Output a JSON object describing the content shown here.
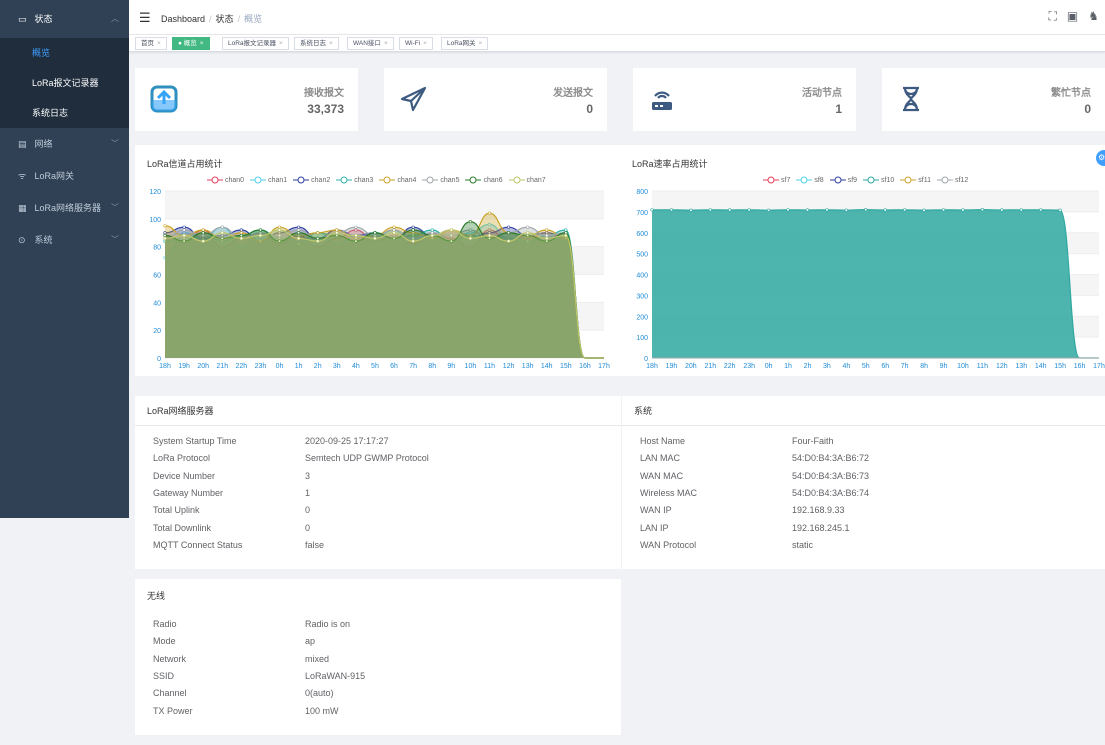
{
  "sidebar": {
    "groups": [
      {
        "label": "状态",
        "icon": "monitor-icon",
        "children": [
          "概览",
          "LoRa报文记录器",
          "系统日志"
        ]
      },
      {
        "label": "网络",
        "icon": "network-icon"
      },
      {
        "label": "LoRa网关",
        "icon": "gateway-icon"
      },
      {
        "label": "LoRa网络服务器",
        "icon": "server-icon"
      },
      {
        "label": "系统",
        "icon": "settings-icon"
      }
    ]
  },
  "breadcrumb": {
    "root": "Dashboard",
    "mid": "状态",
    "current": "概览"
  },
  "tags": [
    "首页",
    "概览",
    "LoRa报文记录器",
    "系统日志",
    "WAN接口",
    "Wi-Fi",
    "LoRa网关"
  ],
  "stats": [
    {
      "label": "接收报文",
      "value": "33,373",
      "icon": "inbox-download-icon",
      "color": "#36a3f7"
    },
    {
      "label": "发送报文",
      "value": "0",
      "icon": "send-plane-icon",
      "color": "#3d5a80"
    },
    {
      "label": "活动节点",
      "value": "1",
      "icon": "router-icon",
      "color": "#3d5a80"
    },
    {
      "label": "繁忙节点",
      "value": "0",
      "icon": "hourglass-icon",
      "color": "#3d5a80"
    }
  ],
  "chart_data": [
    {
      "type": "area",
      "title": "LoRa信道占用统计",
      "x": [
        "18h",
        "19h",
        "20h",
        "21h",
        "22h",
        "23h",
        "0h",
        "1h",
        "2h",
        "3h",
        "4h",
        "5h",
        "6h",
        "7h",
        "8h",
        "9h",
        "10h",
        "11h",
        "12h",
        "13h",
        "14h",
        "15h",
        "16h",
        "17h"
      ],
      "ylim": [
        0,
        120
      ],
      "yticks": [
        0,
        20,
        40,
        60,
        80,
        100,
        120
      ],
      "series": [
        {
          "name": "chan0",
          "color": "#e03e5b",
          "values": [
            88,
            84,
            92,
            80,
            86,
            90,
            82,
            88,
            80,
            86,
            92,
            84,
            88,
            82,
            90,
            86,
            80,
            92,
            84,
            88,
            86,
            90,
            0,
            0
          ]
        },
        {
          "name": "chan1",
          "color": "#4fd1e8",
          "values": [
            72,
            90,
            86,
            94,
            80,
            88,
            92,
            84,
            90,
            82,
            88,
            86,
            92,
            80,
            88,
            84,
            90,
            96,
            86,
            82,
            88,
            84,
            0,
            0
          ]
        },
        {
          "name": "chan2",
          "color": "#2f3e9e",
          "values": [
            90,
            94,
            86,
            88,
            92,
            84,
            90,
            94,
            86,
            92,
            88,
            90,
            86,
            94,
            88,
            92,
            86,
            90,
            94,
            88,
            90,
            86,
            0,
            0
          ]
        },
        {
          "name": "chan3",
          "color": "#2eb2a6",
          "values": [
            84,
            86,
            90,
            84,
            88,
            92,
            86,
            82,
            90,
            88,
            84,
            90,
            86,
            88,
            92,
            84,
            88,
            86,
            90,
            84,
            88,
            92,
            0,
            0
          ]
        },
        {
          "name": "chan4",
          "color": "#c9a227",
          "values": [
            95,
            88,
            92,
            86,
            90,
            84,
            94,
            88,
            90,
            92,
            86,
            88,
            94,
            90,
            86,
            92,
            88,
            104,
            90,
            88,
            92,
            86,
            0,
            0
          ]
        },
        {
          "name": "chan5",
          "color": "#9fa6a8",
          "values": [
            86,
            92,
            88,
            94,
            86,
            90,
            88,
            92,
            86,
            90,
            94,
            88,
            92,
            86,
            90,
            88,
            92,
            86,
            90,
            94,
            88,
            90,
            0,
            0
          ]
        },
        {
          "name": "chan6",
          "color": "#2a7b2a",
          "values": [
            88,
            84,
            90,
            86,
            88,
            92,
            84,
            90,
            86,
            88,
            84,
            90,
            86,
            92,
            88,
            84,
            98,
            86,
            90,
            88,
            84,
            90,
            0,
            0
          ]
        },
        {
          "name": "chan7",
          "color": "#bfc76a",
          "values": [
            86,
            88,
            84,
            90,
            86,
            88,
            92,
            86,
            84,
            90,
            88,
            86,
            90,
            84,
            88,
            92,
            86,
            88,
            84,
            90,
            86,
            88,
            0,
            0
          ]
        }
      ]
    },
    {
      "type": "area",
      "title": "LoRa速率占用统计",
      "x": [
        "18h",
        "19h",
        "20h",
        "21h",
        "22h",
        "23h",
        "0h",
        "1h",
        "2h",
        "3h",
        "4h",
        "5h",
        "6h",
        "7h",
        "8h",
        "9h",
        "10h",
        "11h",
        "12h",
        "13h",
        "14h",
        "15h",
        "16h",
        "17h"
      ],
      "ylim": [
        0,
        800
      ],
      "yticks": [
        0,
        100,
        200,
        300,
        400,
        500,
        600,
        700,
        800
      ],
      "series": [
        {
          "name": "sf7",
          "color": "#e03e5b",
          "values": [
            0,
            0,
            0,
            0,
            0,
            0,
            0,
            0,
            0,
            0,
            0,
            0,
            0,
            0,
            0,
            0,
            0,
            0,
            0,
            0,
            0,
            0,
            0,
            0
          ]
        },
        {
          "name": "sf8",
          "color": "#4fd1e8",
          "values": [
            0,
            0,
            0,
            0,
            0,
            0,
            0,
            0,
            0,
            0,
            0,
            0,
            0,
            0,
            0,
            0,
            0,
            0,
            0,
            0,
            0,
            0,
            0,
            0
          ]
        },
        {
          "name": "sf9",
          "color": "#2f3e9e",
          "values": [
            0,
            0,
            0,
            0,
            0,
            0,
            0,
            0,
            0,
            0,
            0,
            0,
            0,
            0,
            0,
            0,
            0,
            0,
            0,
            0,
            0,
            0,
            0,
            0
          ]
        },
        {
          "name": "sf10",
          "color": "#2ea8a0",
          "values": [
            710,
            710,
            708,
            710,
            709,
            710,
            708,
            710,
            709,
            710,
            708,
            711,
            709,
            710,
            708,
            710,
            709,
            711,
            709,
            710,
            710,
            708,
            0,
            0
          ]
        },
        {
          "name": "sf11",
          "color": "#c9a227",
          "values": [
            0,
            0,
            0,
            0,
            0,
            0,
            0,
            0,
            0,
            0,
            0,
            0,
            0,
            0,
            0,
            0,
            0,
            0,
            0,
            0,
            0,
            0,
            0,
            0
          ]
        },
        {
          "name": "sf12",
          "color": "#9fa6a8",
          "values": [
            0,
            0,
            0,
            0,
            0,
            0,
            0,
            0,
            0,
            0,
            0,
            0,
            0,
            0,
            0,
            0,
            0,
            0,
            0,
            0,
            0,
            0,
            0,
            0
          ]
        }
      ]
    }
  ],
  "lns": {
    "title": "LoRa网络服务器",
    "rows": [
      {
        "k": "System Startup Time",
        "v": "2020-09-25 17:17:27"
      },
      {
        "k": "LoRa Protocol",
        "v": "Semtech UDP GWMP Protocol"
      },
      {
        "k": "Device Number",
        "v": "3"
      },
      {
        "k": "Gateway Number",
        "v": "1"
      },
      {
        "k": "Total Uplink",
        "v": "0"
      },
      {
        "k": "Total Downlink",
        "v": "0"
      },
      {
        "k": "MQTT Connect Status",
        "v": "false"
      }
    ]
  },
  "system": {
    "title": "系统",
    "rows": [
      {
        "k": "Host Name",
        "v": "Four-Faith"
      },
      {
        "k": "LAN MAC",
        "v": "54:D0:B4:3A:B6:72"
      },
      {
        "k": "WAN MAC",
        "v": "54:D0:B4:3A:B6:73"
      },
      {
        "k": "Wireless MAC",
        "v": "54:D0:B4:3A:B6:74"
      },
      {
        "k": "WAN IP",
        "v": "192.168.9.33"
      },
      {
        "k": "LAN IP",
        "v": "192.168.245.1"
      },
      {
        "k": "WAN Protocol",
        "v": "static"
      }
    ]
  },
  "wireless": {
    "title": "无线",
    "rows": [
      {
        "k": "Radio",
        "v": "Radio is on"
      },
      {
        "k": "Mode",
        "v": "ap"
      },
      {
        "k": "Network",
        "v": "mixed"
      },
      {
        "k": "SSID",
        "v": "LoRaWAN-915"
      },
      {
        "k": "Channel",
        "v": "0(auto)"
      },
      {
        "k": "TX Power",
        "v": "100 mW"
      }
    ]
  }
}
